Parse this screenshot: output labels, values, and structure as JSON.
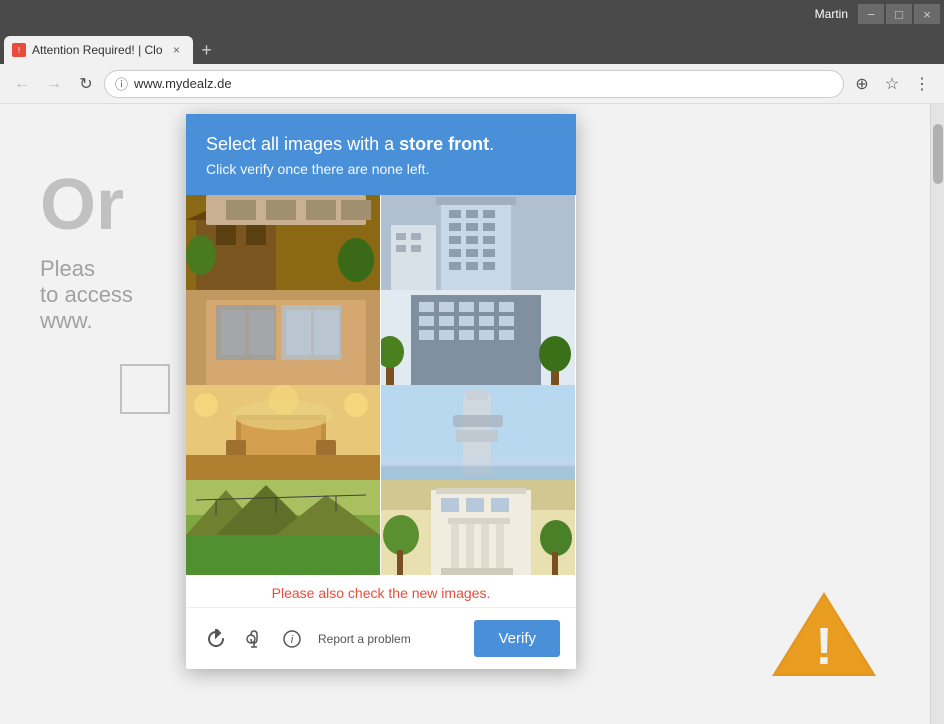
{
  "browser": {
    "user_label": "Martin",
    "minimize_label": "−",
    "maximize_label": "□",
    "close_label": "×",
    "tab_title": "Attention Required! | Clo",
    "new_tab_label": "+",
    "back_label": "←",
    "forward_label": "→",
    "reload_label": "↻",
    "address": "www.mydealz.de",
    "ext_icon_label": "⊕",
    "star_label": "☆",
    "menu_label": "⋮"
  },
  "page": {
    "title_partial": "Or",
    "subtitle_partial": "Pleas",
    "access_text": "to access",
    "url_partial": "www."
  },
  "captcha": {
    "header_text_prefix": "Select all images with a ",
    "header_text_bold": "store front",
    "header_text_suffix": ".",
    "header_subtitle": "Click verify once there are none left.",
    "notice": "Please also check the new images.",
    "verify_label": "Verify",
    "report_label": "Report a problem",
    "images": [
      {
        "id": 1,
        "alt": "brick house building",
        "css_class": "img-1"
      },
      {
        "id": 2,
        "alt": "tall hotel building",
        "css_class": "img-2"
      },
      {
        "id": 3,
        "alt": "glass storefront building",
        "css_class": "img-3"
      },
      {
        "id": 4,
        "alt": "office building with trees",
        "css_class": "img-4"
      },
      {
        "id": 5,
        "alt": "decorated interior hall",
        "css_class": "img-5"
      },
      {
        "id": 6,
        "alt": "tower structure",
        "css_class": "img-6"
      },
      {
        "id": 7,
        "alt": "green landscape",
        "css_class": "img-7"
      },
      {
        "id": 8,
        "alt": "white building exterior",
        "css_class": "img-8"
      }
    ],
    "icons": {
      "refresh": "↺",
      "headphone": "🎧",
      "info": "ℹ"
    }
  }
}
